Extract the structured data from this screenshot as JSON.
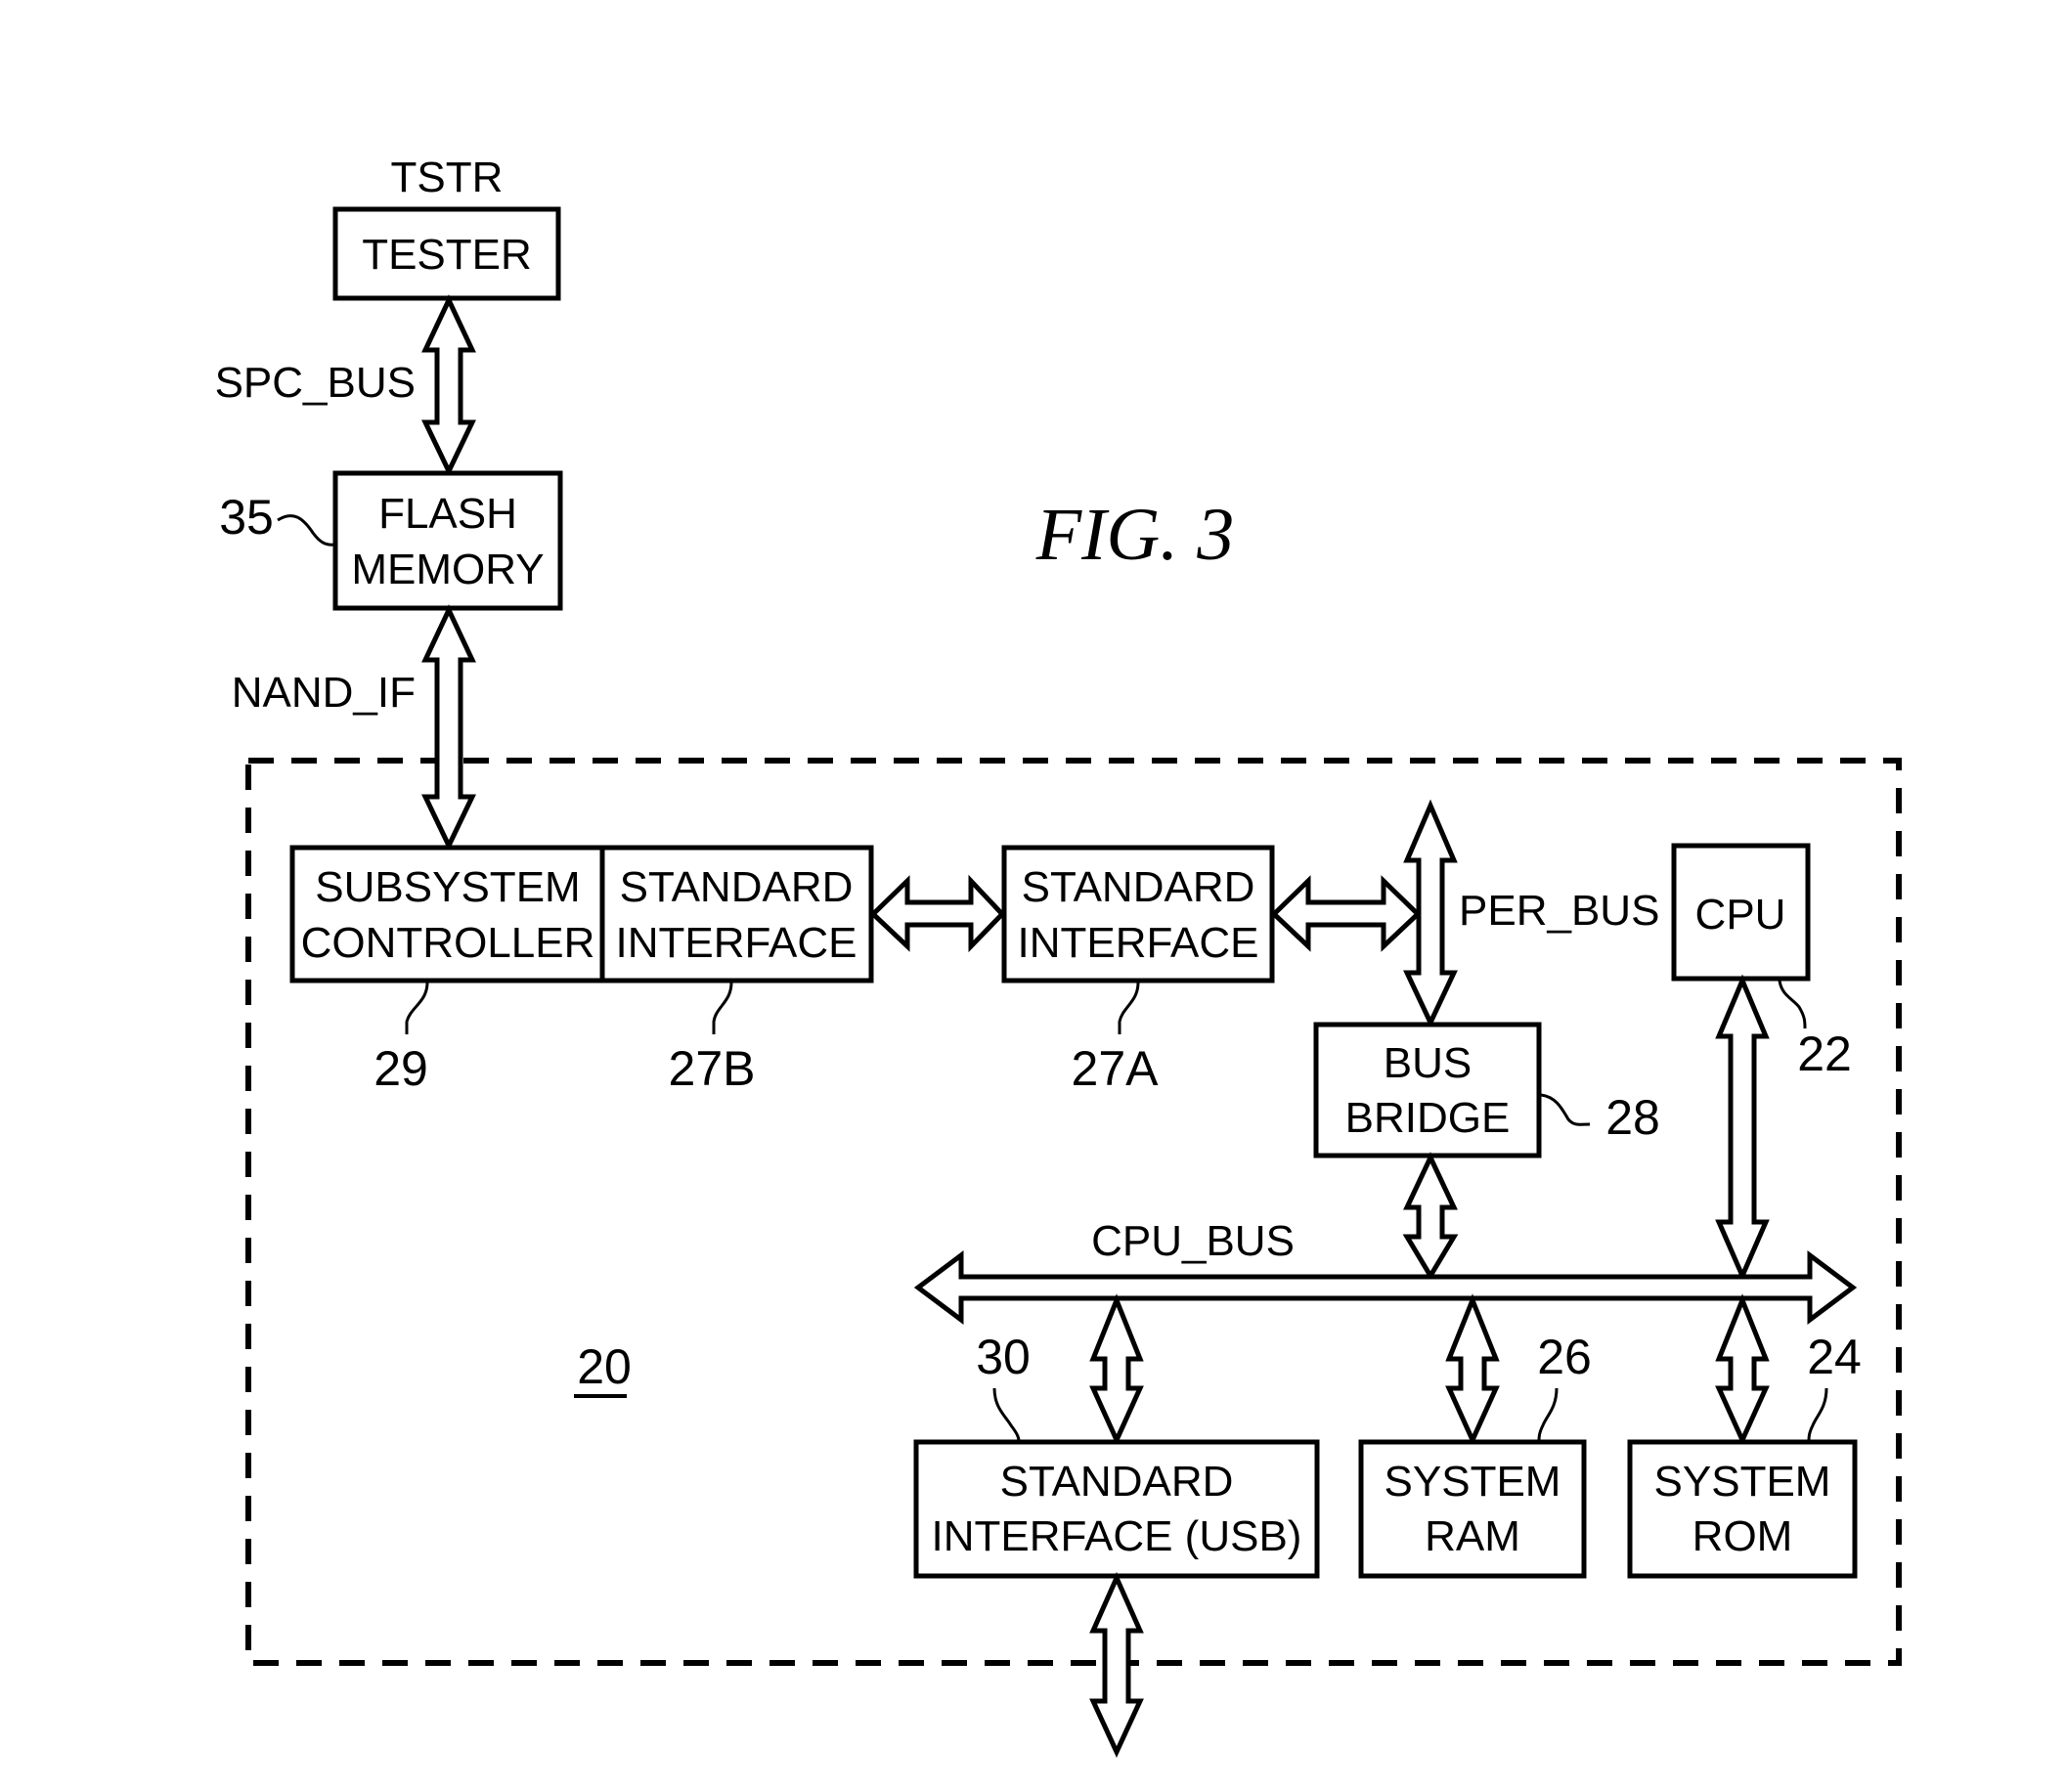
{
  "figure": {
    "title": "FIG. 3",
    "system_ref": "20"
  },
  "blocks": {
    "tester": {
      "label": "TESTER",
      "tag": "TSTR"
    },
    "flash": {
      "line1": "FLASH",
      "line2": "MEMORY",
      "ref": "35"
    },
    "subsystem_controller": {
      "line1": "SUBSYSTEM",
      "line2": "CONTROLLER",
      "ref": "29"
    },
    "std_interface_b": {
      "line1": "STANDARD",
      "line2": "INTERFACE",
      "ref": "27B"
    },
    "std_interface_a": {
      "line1": "STANDARD",
      "line2": "INTERFACE",
      "ref": "27A"
    },
    "bus_bridge": {
      "line1": "BUS",
      "line2": "BRIDGE",
      "ref": "28"
    },
    "cpu": {
      "label": "CPU",
      "ref": "22"
    },
    "std_interface_usb": {
      "line1": "STANDARD",
      "line2": "INTERFACE (USB)",
      "ref": "30"
    },
    "system_ram": {
      "line1": "SYSTEM",
      "line2": "RAM",
      "ref": "26"
    },
    "system_rom": {
      "line1": "SYSTEM",
      "line2": "ROM",
      "ref": "24"
    }
  },
  "buses": {
    "spc_bus": "SPC_BUS",
    "nand_if": "NAND_IF",
    "per_bus": "PER_BUS",
    "cpu_bus": "CPU_BUS"
  }
}
